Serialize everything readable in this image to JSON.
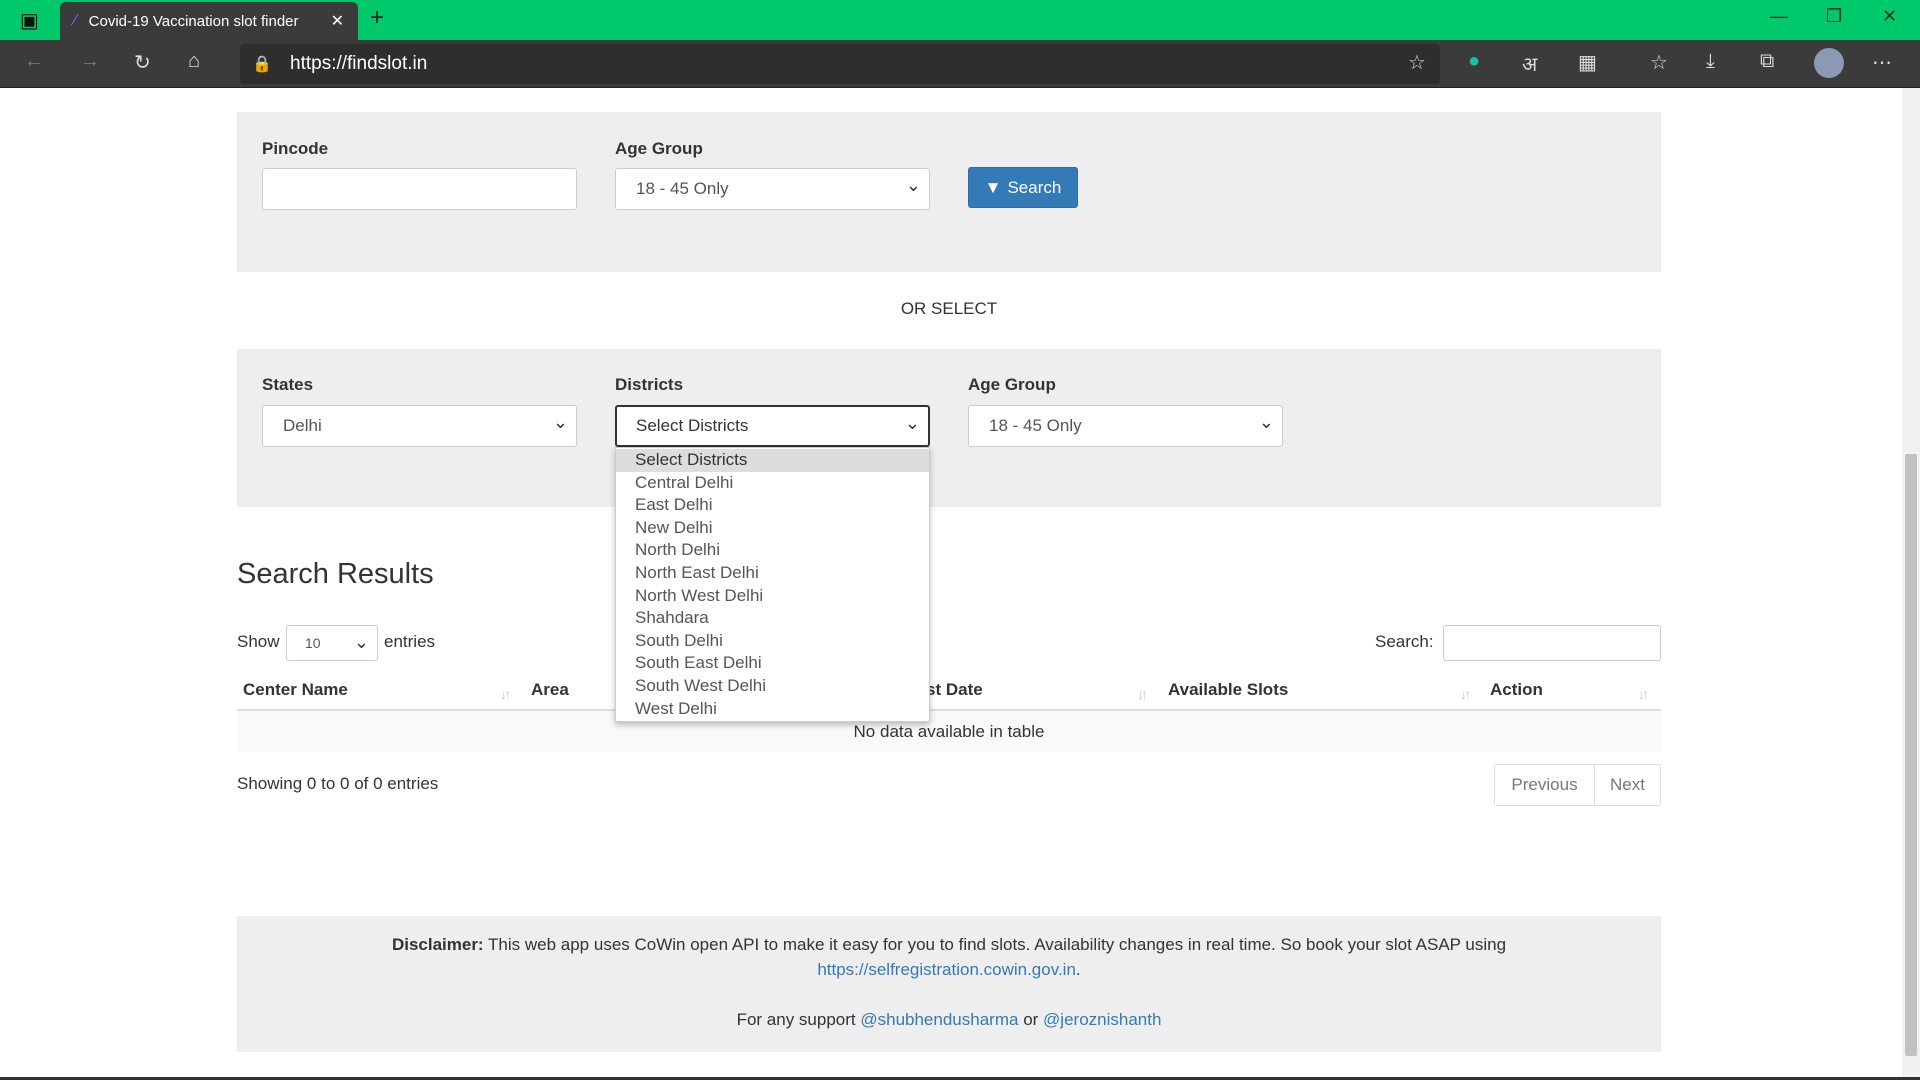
{
  "browser": {
    "tab_title": "Covid-19 Vaccination slot finder",
    "url": "https://findslot.in",
    "accent": "#00c96b"
  },
  "search_panel": {
    "pincode_label": "Pincode",
    "pincode_value": "",
    "age_label": "Age Group",
    "age_value": "18 - 45 Only",
    "search_label": "Search"
  },
  "or_select": "OR SELECT",
  "select_panel": {
    "states_label": "States",
    "states_value": "Delhi",
    "districts_label": "Districts",
    "districts_value": "Select Districts",
    "age_label": "Age Group",
    "age_value": "18 - 45 Only"
  },
  "districts_options": [
    "Select Districts",
    "Central Delhi",
    "East Delhi",
    "New Delhi",
    "North Delhi",
    "North East Delhi",
    "North West Delhi",
    "Shahdara",
    "South Delhi",
    "South East Delhi",
    "South West Delhi",
    "West Delhi"
  ],
  "results": {
    "title": "Search Results",
    "show_label": "Show",
    "entries_value": "10",
    "entries_label": "entries",
    "search_label": "Search:",
    "columns": [
      "Center Name",
      "Area",
      "st Date",
      "Available Slots",
      "Action"
    ],
    "empty": "No data available in table",
    "info": "Showing 0 to 0 of 0 entries",
    "prev": "Previous",
    "next": "Next"
  },
  "footer": {
    "disclaimer_label": "Disclaimer:",
    "disclaimer_text": " This web app uses CoWin open API to make it easy for you to find slots. Availability changes in real time. So book your slot ASAP using",
    "link": "https://selfregistration.cowin.gov.in",
    "support_text": "For any support",
    "user1": "@shubhendusharma",
    "or": "or",
    "user2": "@jeroznishanth"
  }
}
